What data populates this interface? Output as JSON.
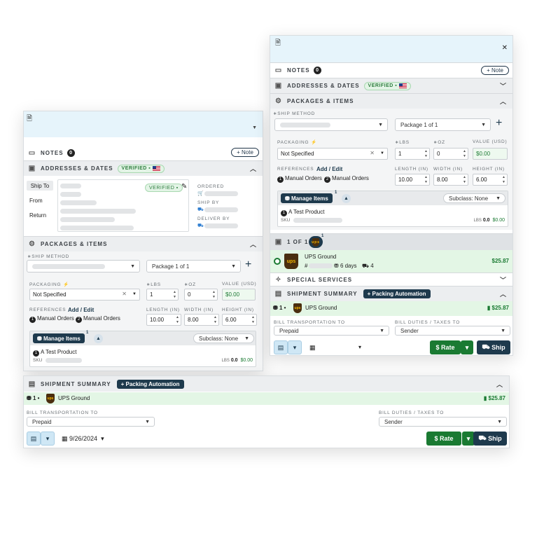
{
  "notes": {
    "label": "NOTES",
    "count": "0",
    "button": "Note"
  },
  "addresses": {
    "label": "ADDRESSES & DATES",
    "verified": "VERIFIED"
  },
  "packages": {
    "label": "PACKAGES & ITEMS"
  },
  "addr_tabs": [
    "Ship To",
    "From",
    "Return"
  ],
  "dates": {
    "ordered": "ORDERED",
    "ship_by": "SHIP BY",
    "deliver_by": "DELIVER BY"
  },
  "ship_method": {
    "label": "SHIP METHOD",
    "package": "Package 1 of 1"
  },
  "packaging": {
    "label": "PACKAGING",
    "value": "Not Specified"
  },
  "weight": {
    "lbs_label": "LBS",
    "oz_label": "OZ",
    "value_label": "VALUE (USD)",
    "lbs": "1",
    "oz": "0",
    "value": "$0.00"
  },
  "references": {
    "label": "REFERENCES",
    "add_edit": "Add / Edit",
    "ref1_num": "1",
    "ref1": "Manual Orders",
    "ref2_num": "2",
    "ref2": "Manual Orders"
  },
  "dims": {
    "length_label": "LENGTH (IN)",
    "width_label": "WIDTH (IN)",
    "height_label": "HEIGHT (IN)",
    "length": "10.00",
    "width": "8.00",
    "height": "6.00"
  },
  "items": {
    "manage": "Manage Items",
    "manage_count": "1",
    "subclass": "Subclass: None",
    "qty": "1",
    "product": "A Test Product",
    "sku_label": "SKU",
    "lbs_label": "LBS",
    "lbs": "0.0",
    "price": "$0.00"
  },
  "rates": {
    "count_label": "1 OF 1",
    "badge": "1",
    "carrier": "UPS Ground",
    "hash": "#",
    "days": "6 days",
    "trucks": "4",
    "price": "$25.87",
    "logo": "ups"
  },
  "special": {
    "label": "SPECIAL SERVICES"
  },
  "summary": {
    "label": "SHIPMENT SUMMARY",
    "automation": "Packing Automation",
    "pkg_count": "1",
    "carrier": "UPS Ground",
    "price": "$25.87"
  },
  "billing": {
    "transport_label": "BILL TRANSPORTATION TO",
    "transport": "Prepaid",
    "duties_label": "BILL DUTIES / TAXES TO",
    "duties": "Sender"
  },
  "actions": {
    "date": "9/26/2024",
    "rate": "Rate",
    "ship": "Ship"
  },
  "colors": {
    "accent_dark": "#1e3a4d",
    "green": "#1a7a32",
    "light_blue": "#e6f4fb",
    "green_row": "#e3f6e5"
  }
}
